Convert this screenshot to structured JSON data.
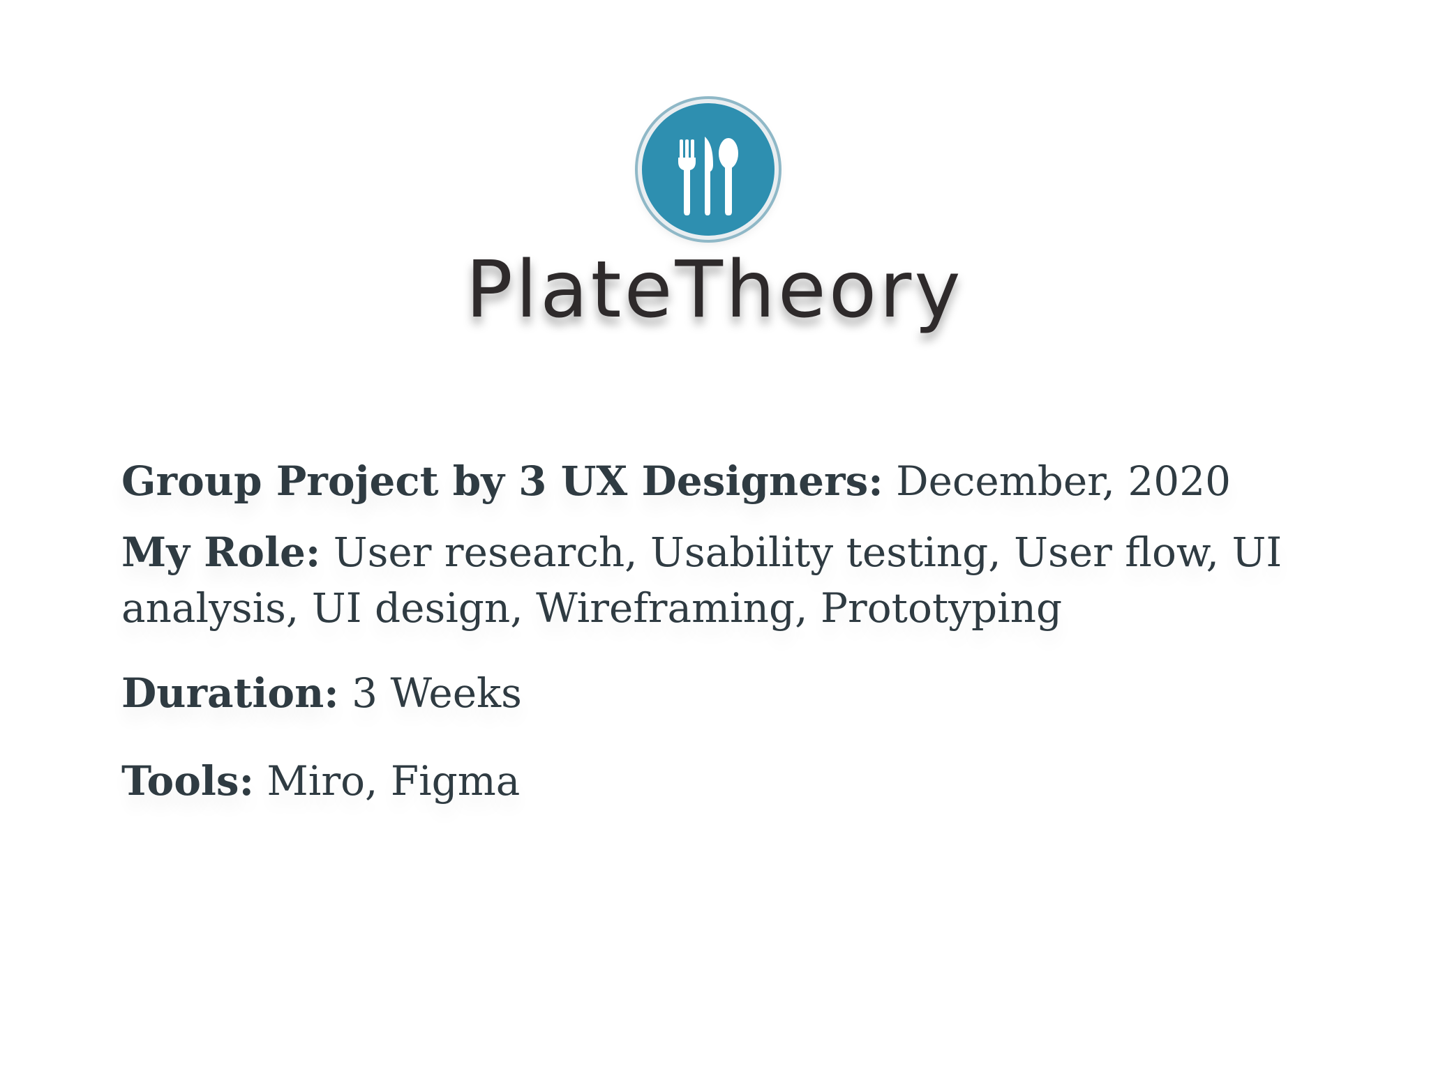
{
  "logo": {
    "wordmark": "PlateTheory",
    "icon": "fork-knife-spoon-icon",
    "emblem_color": "#2e8fb0"
  },
  "details": {
    "group": {
      "label": "Group Project by 3 UX Designers:",
      "value": "December, 2020"
    },
    "role": {
      "label": "My Role:",
      "value": "User research, Usability testing, User flow, UI analysis, UI design, Wireframing, Prototyping"
    },
    "duration": {
      "label": "Duration:",
      "value": "3 Weeks"
    },
    "tools": {
      "label": "Tools:",
      "value": "Miro, Figma"
    }
  },
  "colors": {
    "text": "#2f3b42",
    "wordmark": "#2e2a2b"
  }
}
